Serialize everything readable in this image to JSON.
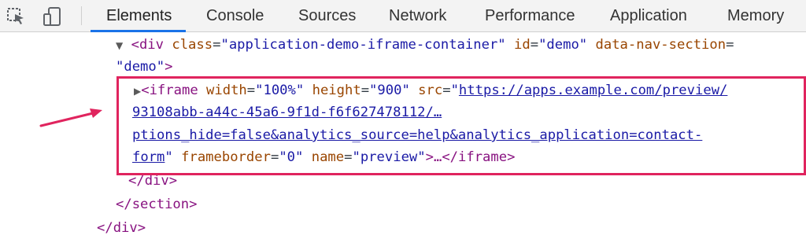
{
  "tabs": [
    {
      "label": "Elements",
      "active": true
    },
    {
      "label": "Console"
    },
    {
      "label": "Sources"
    },
    {
      "label": "Network"
    },
    {
      "label": "Performance"
    },
    {
      "label": "Application"
    },
    {
      "label": "Memory"
    }
  ],
  "icons": {
    "inspect": "element-picker-icon",
    "device": "device-toolbar-icon"
  },
  "colors": {
    "accent": "#1a73e8",
    "highlight_border": "#e0245e",
    "tag": "#881280",
    "attr_name": "#994500",
    "attr_value": "#1a1aa6"
  },
  "dom": {
    "div_open": "<div",
    "div_class_name": "class",
    "div_class_value": "\"application-demo-iframe-container\"",
    "div_id_name": "id",
    "div_id_value": "\"demo\"",
    "div_navsection_name": "data-nav-section",
    "div_navsection_value_cont": "\"demo\"",
    "div_close_bracket": ">",
    "iframe_open": "<iframe",
    "iframe_width_name": "width",
    "iframe_width_value": "\"100%\"",
    "iframe_height_name": "height",
    "iframe_height_value": "\"900\"",
    "iframe_src_name": "src",
    "iframe_src_quote": "\"",
    "iframe_src_line1": "https://apps.example.com/preview/",
    "iframe_src_line2": "93108abb-a44c-45a6-9f1d-f6f627478112/…",
    "iframe_src_line3": "ptions_hide=false&analytics_source=help&analytics_application=contact-",
    "iframe_src_line4": "form",
    "iframe_frameborder_name": "frameborder",
    "iframe_frameborder_value": "\"0\"",
    "iframe_name_name": "name",
    "iframe_name_value": "\"preview\"",
    "iframe_tail": ">…</iframe>",
    "div_close": "</div>",
    "section_close": "</section>",
    "outer_div_close": "</div>"
  }
}
